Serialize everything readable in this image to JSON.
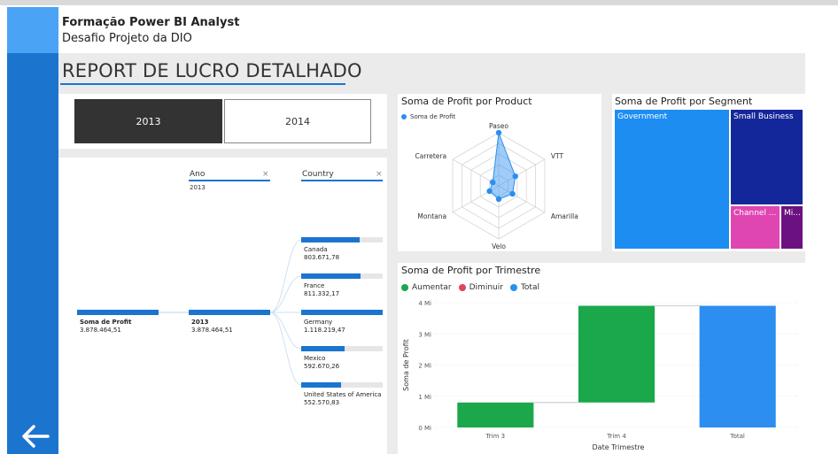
{
  "header": {
    "title": "Formação Power BI Analyst",
    "subtitle": "Desafio Projeto da DIO",
    "report_title": "REPORT DE LUCRO DETALHADO"
  },
  "colors": {
    "accent": "#1b75cf",
    "sidebar_top": "#4aa3f5",
    "aumentar": "#1aa84a",
    "diminuir": "#e0445a",
    "total": "#2b8ef0"
  },
  "year_slicer": {
    "options": [
      "2013",
      "2014"
    ],
    "selected": "2013"
  },
  "decomp_tree": {
    "filters": [
      {
        "label": "Ano",
        "value": "2013",
        "clear": "×"
      },
      {
        "label": "Country",
        "value": "",
        "clear": "×"
      }
    ],
    "root": {
      "label": "Soma de Profit",
      "value": "3.878.464,51"
    },
    "level1": {
      "label": "2013",
      "value": "3.878.464,51"
    },
    "countries": [
      {
        "name": "Canada",
        "value": "803.671,78",
        "share": 0.72
      },
      {
        "name": "France",
        "value": "811.332,17",
        "share": 0.73
      },
      {
        "name": "Germany",
        "value": "1.118.219,47",
        "share": 1.0
      },
      {
        "name": "Mexico",
        "value": "592.670,26",
        "share": 0.53
      },
      {
        "name": "United States of America",
        "value": "552.570,83",
        "share": 0.49
      }
    ]
  },
  "chart_data": [
    {
      "type": "radar",
      "title": "Soma de Profit por Product",
      "legend": [
        "Soma de Profit"
      ],
      "categories": [
        "Paseo",
        "VTT",
        "Amarilla",
        "Velo",
        "Montana",
        "Carretera"
      ],
      "values": [
        1.0,
        0.36,
        0.3,
        0.25,
        0.2,
        0.13
      ]
    },
    {
      "type": "treemap",
      "title": "Soma de Profit por Segment",
      "items": [
        {
          "label": "Government",
          "value": 0.61,
          "color": "#1e8df2"
        },
        {
          "label": "Small Business",
          "value": 0.25,
          "color": "#14279a"
        },
        {
          "label": "Channel ...",
          "value": 0.08,
          "color": "#e046b2"
        },
        {
          "label": "Mi...",
          "value": 0.06,
          "color": "#6c1280"
        }
      ]
    },
    {
      "type": "waterfall",
      "title": "Soma de Profit por Trimestre",
      "legend": [
        "Aumentar",
        "Diminuir",
        "Total"
      ],
      "categories": [
        "Trim 3",
        "Trim 4",
        "Total"
      ],
      "values": [
        0.8,
        3.1,
        3.9
      ],
      "kinds": [
        "increase",
        "increase",
        "total"
      ],
      "xlabel": "Date Trimestre",
      "ylabel": "Soma de Profit",
      "yticks": [
        "0 Mi",
        "1 Mi",
        "2 Mi",
        "3 Mi",
        "4 Mi"
      ],
      "ylim": [
        0,
        4
      ]
    }
  ]
}
